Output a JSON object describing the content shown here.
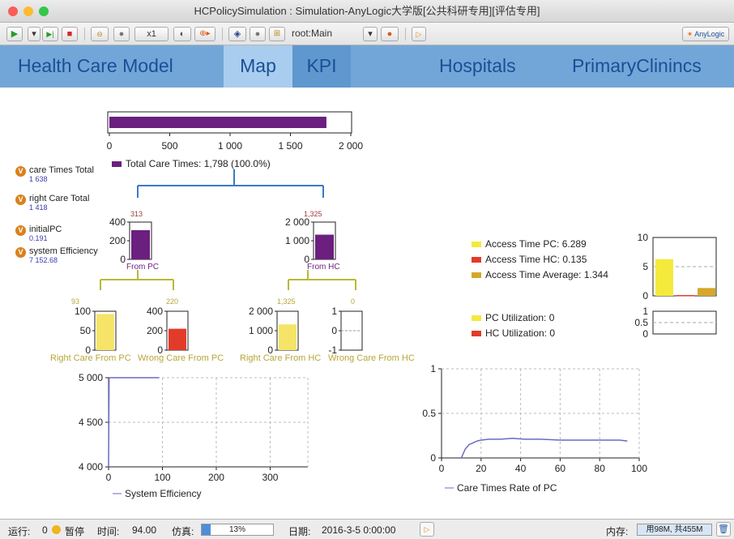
{
  "window": {
    "title": "HCPolicySimulation : Simulation-AnyLogic大学版[公共科研专用][评估专用]"
  },
  "toolbar": {
    "speed": "x1",
    "path": "root:Main",
    "brand": "AnyLogic"
  },
  "menu": {
    "items": [
      {
        "label": "Health Care Model"
      },
      {
        "label": "Map"
      },
      {
        "label": "KPI"
      },
      {
        "label": "Hospitals"
      },
      {
        "label": "PrimaryClinincs"
      }
    ]
  },
  "variables": [
    {
      "name": "care Times Total",
      "value": "1 638"
    },
    {
      "name": "right Care Total",
      "value": "1 418"
    },
    {
      "name": "initialPC",
      "value": "0.191"
    },
    {
      "name": "system Efficiency",
      "value": "7 152.68"
    }
  ],
  "total_chart": {
    "legend": "Total Care Times: 1,798 (100.0%)",
    "ticks": [
      "0",
      "500",
      "1 000",
      "1 500",
      "2 000"
    ]
  },
  "tree": {
    "from_pc": {
      "label": "From PC",
      "value_label": "313",
      "ticks": [
        "400",
        "200",
        "0"
      ]
    },
    "from_hc": {
      "label": "From HC",
      "value_label": "1,325",
      "ticks": [
        "2 000",
        "1 000",
        "0"
      ]
    },
    "right_pc": {
      "label": "Right Care From PC",
      "value_label": "93",
      "ticks": [
        "100",
        "50",
        "0"
      ]
    },
    "wrong_pc": {
      "label": "Wrong Care From PC",
      "value_label": "220",
      "ticks": [
        "400",
        "200",
        "0"
      ]
    },
    "right_hc": {
      "label": "Right Care From HC",
      "value_label": "1,325",
      "ticks": [
        "2 000",
        "1 000",
        "0"
      ]
    },
    "wrong_hc": {
      "label": "Wrong Care From HC",
      "value_label": "0",
      "ticks": [
        "1",
        "0",
        "-1"
      ]
    }
  },
  "access": {
    "legend": [
      {
        "label": "Access Time PC: 6.289",
        "color": "#f4ea3c"
      },
      {
        "label": "Access Time HC: 0.135",
        "color": "#e23b2a"
      },
      {
        "label": "Access Time Average: 1.344",
        "color": "#d6a72a"
      }
    ],
    "ticks": [
      "10",
      "5",
      "0"
    ]
  },
  "utilization": {
    "legend": [
      {
        "label": "PC Utilization: 0",
        "color": "#f4ea3c"
      },
      {
        "label": "HC Utilization: 0",
        "color": "#e23b2a"
      }
    ],
    "ticks": [
      "1",
      "0.5",
      "0"
    ]
  },
  "efficiency_plot": {
    "legend": "System Efficiency",
    "yticks": [
      "5 000",
      "4 500",
      "4 000"
    ],
    "xticks": [
      "0",
      "100",
      "200",
      "300"
    ]
  },
  "rate_plot": {
    "legend": "Care Times Rate of PC",
    "yticks": [
      "1",
      "0.5",
      "0"
    ],
    "xticks": [
      "0",
      "20",
      "40",
      "60",
      "80",
      "100"
    ]
  },
  "chart_data": [
    {
      "type": "bar",
      "categories": [
        "Total Care Times"
      ],
      "values": [
        1798
      ],
      "xlim": [
        0,
        2000
      ]
    },
    {
      "type": "bar",
      "categories": [
        "From PC",
        "From HC"
      ],
      "values": [
        313,
        1325
      ]
    },
    {
      "type": "bar",
      "categories": [
        "Right Care From PC",
        "Wrong Care From PC",
        "Right Care From HC",
        "Wrong Care From HC"
      ],
      "values": [
        93,
        220,
        1325,
        0
      ]
    },
    {
      "type": "bar",
      "categories": [
        "Access Time PC",
        "Access Time HC",
        "Access Time Average"
      ],
      "values": [
        6.289,
        0.135,
        1.344
      ],
      "ylim": [
        0,
        10
      ]
    },
    {
      "type": "bar",
      "categories": [
        "PC Utilization",
        "HC Utilization"
      ],
      "values": [
        0,
        0
      ],
      "ylim": [
        0,
        1
      ]
    },
    {
      "type": "line",
      "series": [
        {
          "name": "System Efficiency",
          "x": [
            0,
            1,
            3,
            20,
            50,
            94
          ],
          "y": [
            4000,
            5000,
            5000,
            5000,
            5000,
            5000
          ]
        }
      ],
      "xlim": [
        0,
        370
      ],
      "ylim": [
        4000,
        5000
      ]
    },
    {
      "type": "line",
      "series": [
        {
          "name": "Care Times Rate of PC",
          "x": [
            10,
            12,
            14,
            16,
            18,
            20,
            24,
            30,
            36,
            42,
            50,
            60,
            70,
            80,
            90,
            94
          ],
          "y": [
            0.0,
            0.1,
            0.15,
            0.17,
            0.19,
            0.2,
            0.21,
            0.21,
            0.22,
            0.21,
            0.21,
            0.2,
            0.2,
            0.2,
            0.2,
            0.19
          ]
        }
      ],
      "xlim": [
        0,
        100
      ],
      "ylim": [
        0,
        1
      ]
    }
  ],
  "status": {
    "run_label": "运行:",
    "run_count": "0",
    "pause_label": "暂停",
    "time_label": "时间:",
    "time_value": "94.00",
    "sim_label": "仿真:",
    "sim_percent": "13%",
    "sim_progress": 0.13,
    "date_label": "日期:",
    "date_value": "2016-3-5 0:00:00",
    "mem_label": "内存:",
    "mem_value": "用98M, 共455M"
  }
}
